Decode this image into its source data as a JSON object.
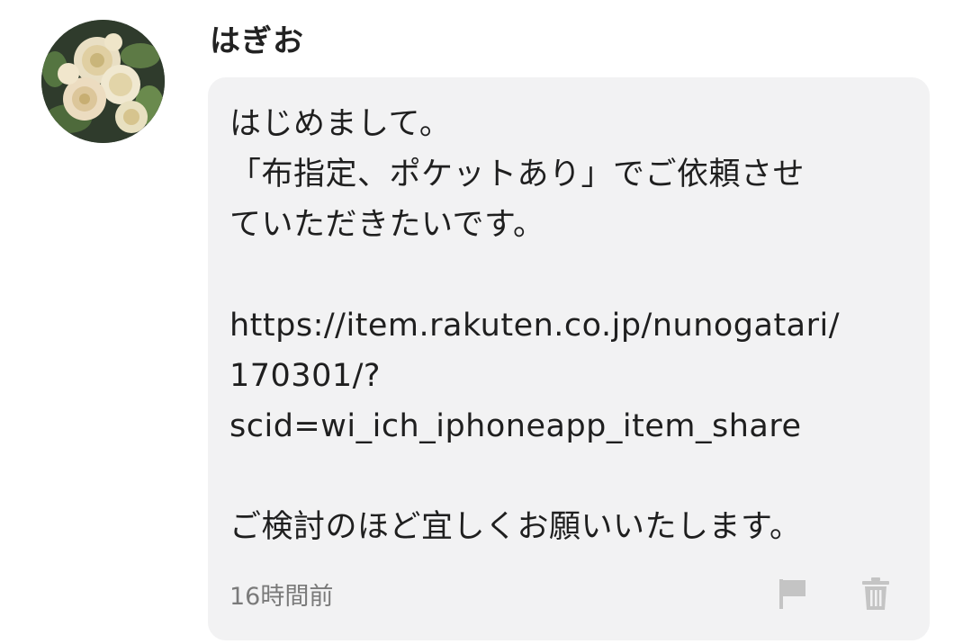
{
  "user": {
    "name": "はぎお",
    "avatar_icon": "flower-photo-avatar"
  },
  "message": {
    "lines": [
      "はじめまして。",
      "「布指定、ポケットあり」でご依頼させ",
      "ていただきたいです。",
      "",
      "https://item.rakuten.co.jp/nunogatari/",
      "170301/?",
      "scid=wi_ich_iphoneapp_item_share",
      "",
      "ご検討のほど宜しくお願いいたします。"
    ],
    "timestamp": "16時間前"
  },
  "actions": {
    "report_icon": "flag-icon",
    "delete_icon": "trash-icon",
    "icon_color": "#c4c4c4"
  },
  "colors": {
    "bubble_background": "#f2f2f3",
    "timestamp": "#7a7a7a"
  }
}
